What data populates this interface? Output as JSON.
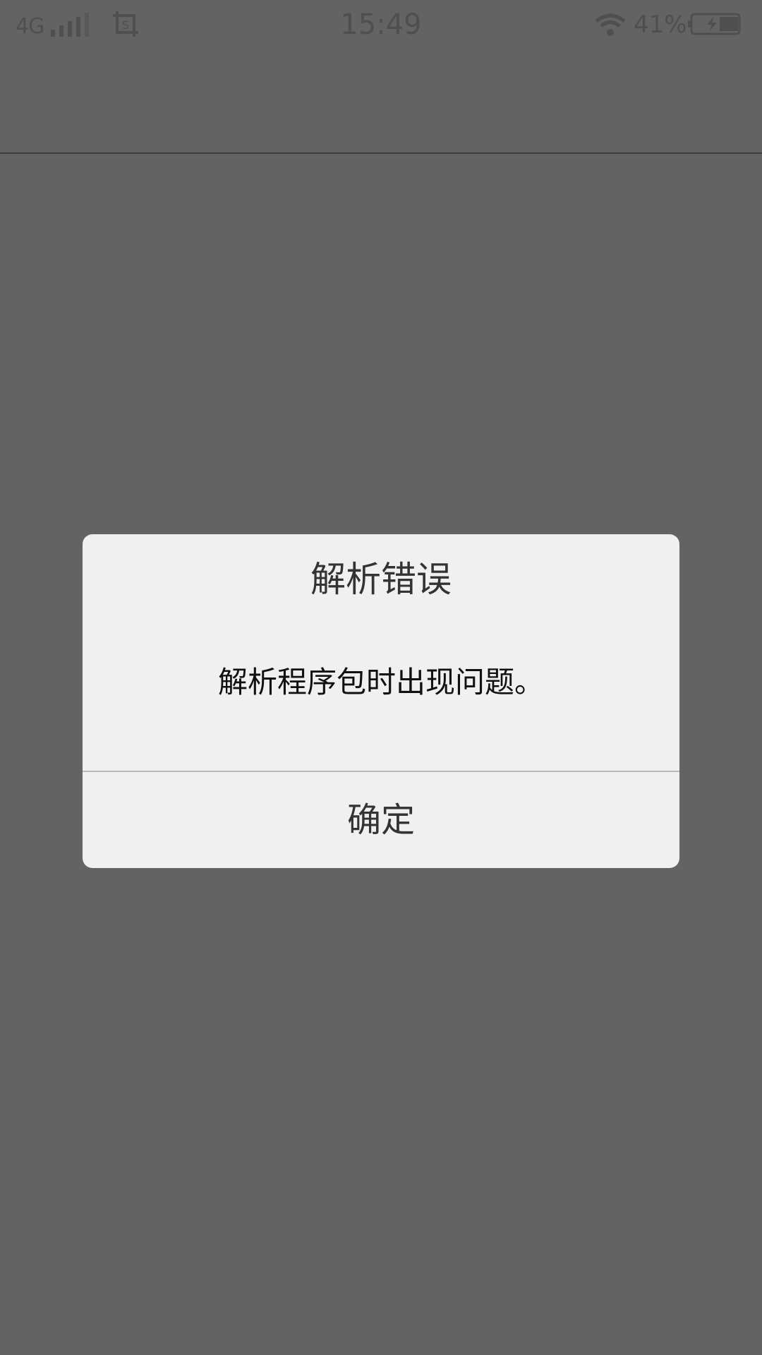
{
  "status_bar": {
    "network": "4G",
    "signal_icon": "cellular-signal-icon",
    "screenshot_icon": "screenshot-icon",
    "time": "15:49",
    "wifi_icon": "wifi-icon",
    "battery_percent": "41%",
    "battery_icon": "battery-charging-icon",
    "battery_level": 0.41
  },
  "dialog": {
    "title": "解析错误",
    "message": "解析程序包时出现问题。",
    "confirm_label": "确定"
  },
  "colors": {
    "overlay_background": "#636363",
    "dialog_background": "#f0f0f0",
    "status_text": "#4f4f4f"
  }
}
